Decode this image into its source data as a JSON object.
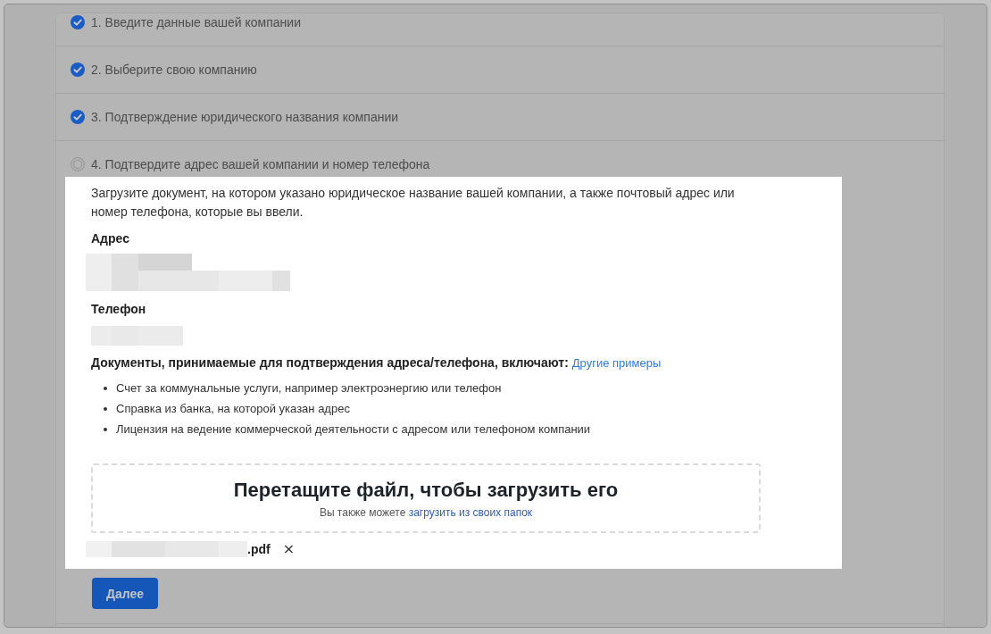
{
  "steps": [
    {
      "label": "1. Введите данные вашей компании",
      "completed": true
    },
    {
      "label": "2. Выберите свою компанию",
      "completed": true
    },
    {
      "label": "3. Подтверждение юридического названия компании",
      "completed": true
    },
    {
      "label": "4. Подтвердите адрес вашей компании и номер телефона",
      "completed": false
    }
  ],
  "current_step": {
    "intro": "Загрузите документ, на котором указано юридическое название вашей компании, а также почтовый адрес или номер телефона, которые вы ввели.",
    "address": {
      "label": "Адрес",
      "redacted": true
    },
    "phone": {
      "label": "Телефон",
      "redacted": true
    },
    "documents": {
      "heading": "Документы, принимаемые для подтверждения адреса/телефона, включают:",
      "link": "Другие примеры",
      "items": [
        "Счет за коммунальные услуги, например электроэнергию или телефон",
        "Справка из банка, на которой указан адрес",
        "Лицензия на ведение коммерческой деятельности с адресом или телефоном компании"
      ]
    },
    "dropzone": {
      "title": "Перетащите файл, чтобы загрузить его",
      "hint": "Вы также можете",
      "link": "загрузить из своих папок"
    },
    "file": {
      "name": ".pdf",
      "redacted": true,
      "remove": "×"
    },
    "next_button": "Далее"
  }
}
